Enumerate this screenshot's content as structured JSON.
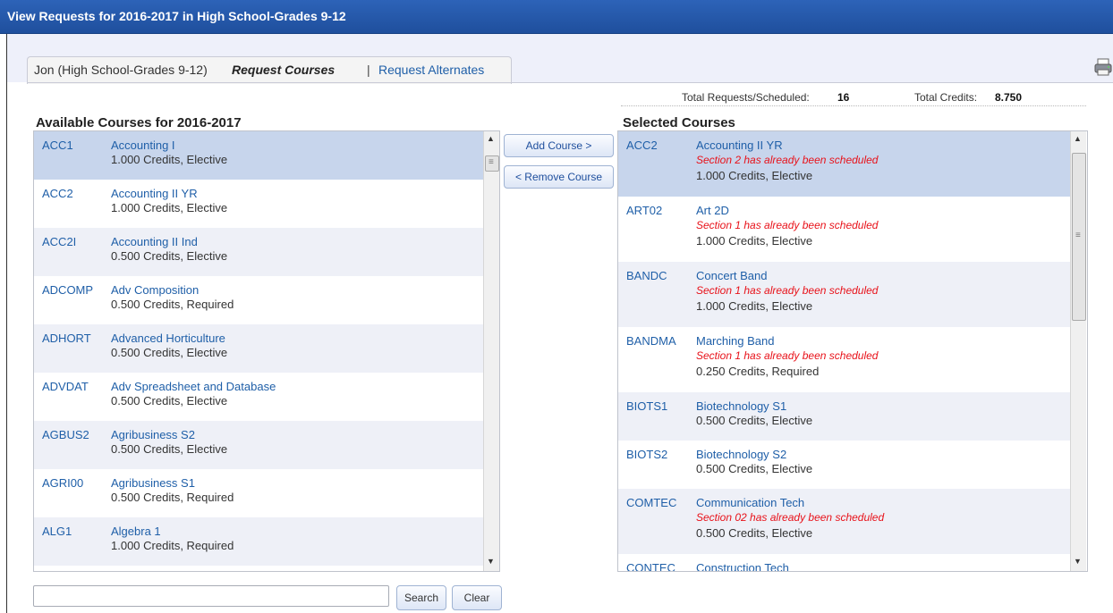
{
  "title": "View Requests for 2016-2017 in High School-Grades 9-12",
  "tabs": {
    "student": "Jon (High School-Grades 9-12)",
    "request_courses": "Request Courses",
    "separator": "|",
    "request_alternates": "Request Alternates"
  },
  "totals": {
    "requests_label": "Total Requests/Scheduled:",
    "requests_value": "16",
    "credits_label": "Total Credits:",
    "credits_value": "8.750"
  },
  "available": {
    "title": "Available Courses for 2016-2017",
    "courses": [
      {
        "code": "ACC1",
        "name": "Accounting I",
        "credits": "1.000 Credits,  Elective"
      },
      {
        "code": "ACC2",
        "name": "Accounting II YR",
        "credits": "1.000 Credits,  Elective"
      },
      {
        "code": "ACC2I",
        "name": "Accounting II Ind",
        "credits": "0.500 Credits,  Elective"
      },
      {
        "code": "ADCOMP",
        "name": "Adv Composition",
        "credits": "0.500 Credits,  Required"
      },
      {
        "code": "ADHORT",
        "name": "Advanced Horticulture",
        "credits": "0.500 Credits,  Elective"
      },
      {
        "code": "ADVDAT",
        "name": "Adv Spreadsheet and Database",
        "credits": "0.500 Credits,  Elective"
      },
      {
        "code": "AGBUS2",
        "name": "Agribusiness S2",
        "credits": "0.500 Credits,  Elective"
      },
      {
        "code": "AGRI00",
        "name": "Agribusiness S1",
        "credits": "0.500 Credits,  Required"
      },
      {
        "code": "ALG1",
        "name": "Algebra 1",
        "credits": "1.000 Credits,  Required"
      }
    ]
  },
  "selected": {
    "title": "Selected Courses",
    "courses": [
      {
        "code": "ACC2",
        "name": "Accounting II YR",
        "warning": "Section 2 has already been scheduled",
        "credits": "1.000 Credits,  Elective"
      },
      {
        "code": "ART02",
        "name": "Art 2D",
        "warning": "Section 1 has already been scheduled",
        "credits": "1.000 Credits,  Elective"
      },
      {
        "code": "BANDC",
        "name": "Concert Band",
        "warning": "Section 1 has already been scheduled",
        "credits": "1.000 Credits,  Elective"
      },
      {
        "code": "BANDMA",
        "name": "Marching Band",
        "warning": "Section 1 has already been scheduled",
        "credits": "0.250 Credits,  Required"
      },
      {
        "code": "BIOTS1",
        "name": "Biotechnology S1",
        "warning": "",
        "credits": "0.500 Credits,  Elective"
      },
      {
        "code": "BIOTS2",
        "name": "Biotechnology S2",
        "warning": "",
        "credits": "0.500 Credits,  Elective"
      },
      {
        "code": "COMTEC",
        "name": "Communication Tech",
        "warning": "Section 02 has already been scheduled",
        "credits": "0.500 Credits,  Elective"
      },
      {
        "code": "CONTEC",
        "name": "Construction Tech",
        "warning": "",
        "credits": ""
      }
    ]
  },
  "buttons": {
    "add": "Add Course >",
    "remove": "< Remove Course",
    "search": "Search",
    "clear": "Clear"
  },
  "search": {
    "value": "",
    "placeholder": ""
  },
  "icons": {
    "printer": "printer-icon"
  }
}
